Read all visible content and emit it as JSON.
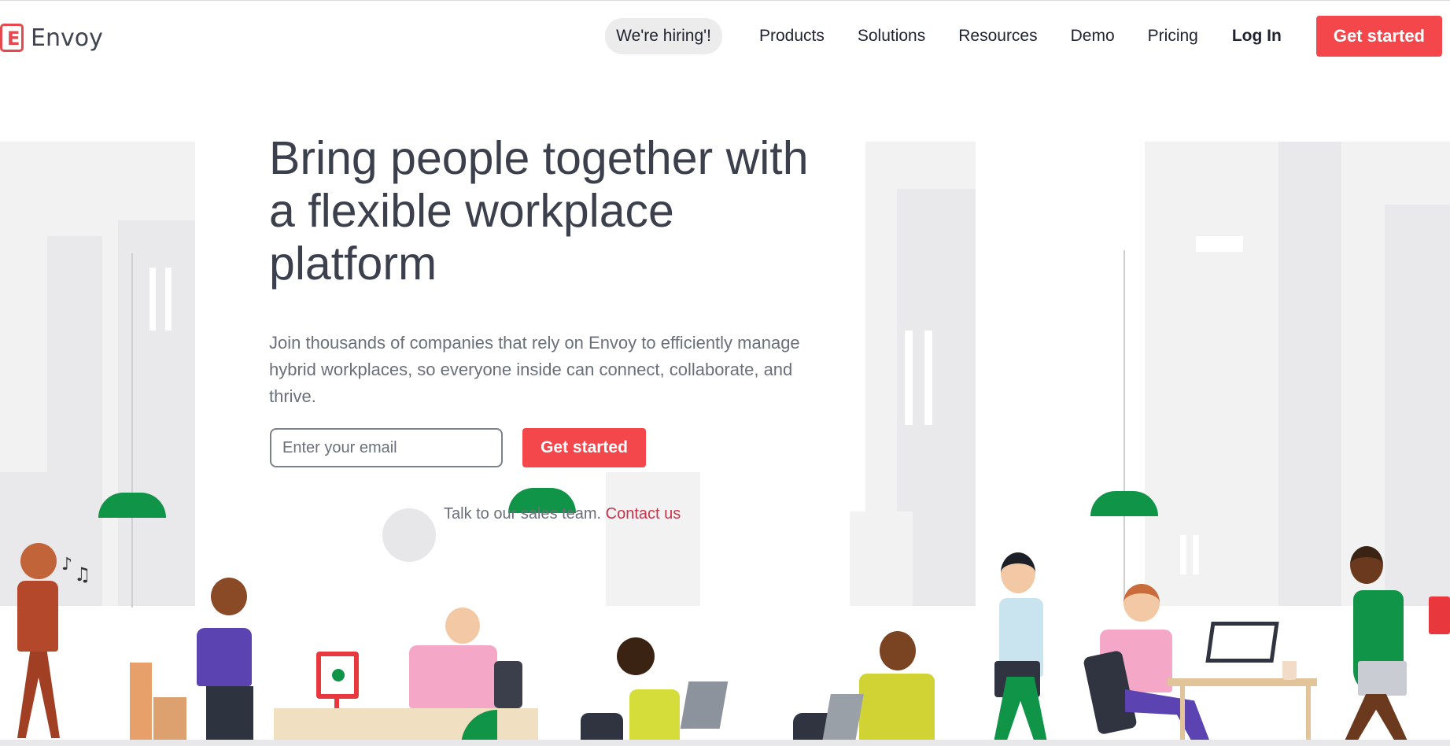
{
  "brand": {
    "name": "Envoy",
    "logo_letter": "E",
    "color": "#e5484d"
  },
  "nav": {
    "hiring": "We're hiring'!",
    "links": [
      "Products",
      "Solutions",
      "Resources",
      "Demo",
      "Pricing"
    ],
    "login": "Log In",
    "cta": "Get started"
  },
  "hero": {
    "title": "Bring people together with a flexible workplace platform",
    "subtitle": "Join thousands of companies that rely on Envoy to efficiently manage hybrid workplaces, so everyone inside can connect, collaborate, and thrive.",
    "email_placeholder": "Enter your email",
    "cta": "Get started",
    "talk_text": "Talk to our sales team.",
    "contact_link": "Contact us"
  },
  "colors": {
    "accent": "#f4474c",
    "lamp": "#0f9448",
    "text": "#3c404c",
    "muted": "#6b6f7a"
  },
  "illustration": {
    "icons": [
      "music-notes-icon",
      "checkmark-icon",
      "clock-icon"
    ]
  }
}
